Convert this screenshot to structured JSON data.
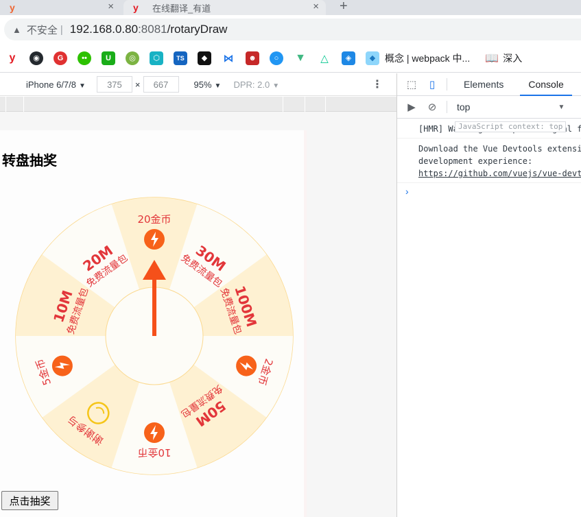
{
  "browser": {
    "tabs": [
      {
        "title": ""
      },
      {
        "title": "在线翻译_有道"
      }
    ],
    "new_tab": "+",
    "close": "×",
    "security_label": "不安全",
    "separator": "|",
    "url_host": "192.168.0.80",
    "url_port": ":8081",
    "url_path": "/rotaryDraw",
    "bookmark_text_1": "概念 | webpack 中...",
    "bookmark_text_2": "深入"
  },
  "device_toolbar": {
    "device": "iPhone 6/7/8",
    "width": "375",
    "times": "×",
    "height": "667",
    "zoom": "95%",
    "dpr": "DPR: 2.0"
  },
  "page": {
    "title": "转盘抽奖",
    "button_label": "点击抽奖"
  },
  "wheel": {
    "segments": [
      {
        "line1": "20金币",
        "line2": "",
        "icon": "coin"
      },
      {
        "line1": "30M",
        "line2": "免费流量包",
        "icon": ""
      },
      {
        "line1": "100M",
        "line2": "免费流量包",
        "icon": ""
      },
      {
        "line1": "2金币",
        "line2": "",
        "icon": "coin"
      },
      {
        "line1": "50M",
        "line2": "免费流量包",
        "icon": ""
      },
      {
        "line1": "10金币",
        "line2": "",
        "icon": "coin"
      },
      {
        "line1": "谢谢参与",
        "line2": "",
        "icon": "smile"
      },
      {
        "line1": "5金币",
        "line2": "",
        "icon": "coin"
      },
      {
        "line1": "10M",
        "line2": "免费流量包",
        "icon": ""
      },
      {
        "line1": "20M",
        "line2": "免费流量包",
        "icon": ""
      }
    ],
    "colors": {
      "light": "#fdfcf7",
      "dark": "#fef1d2",
      "border": "#fbd98f",
      "text": "#e2363a",
      "icon": "#f7621a",
      "arrow": "#f5501a"
    }
  },
  "devtools": {
    "tabs": [
      "Elements",
      "Console"
    ],
    "context": "top",
    "log1": "[HMR] Waiting for update signal from WDS...",
    "tooltip": "JavaScript context: top",
    "log2_line1": "Download the Vue Devtools extension for a better",
    "log2_line2": "development experience:",
    "log2_link": "https://github.com/vuejs/vue-devtools",
    "prompt": "›"
  }
}
